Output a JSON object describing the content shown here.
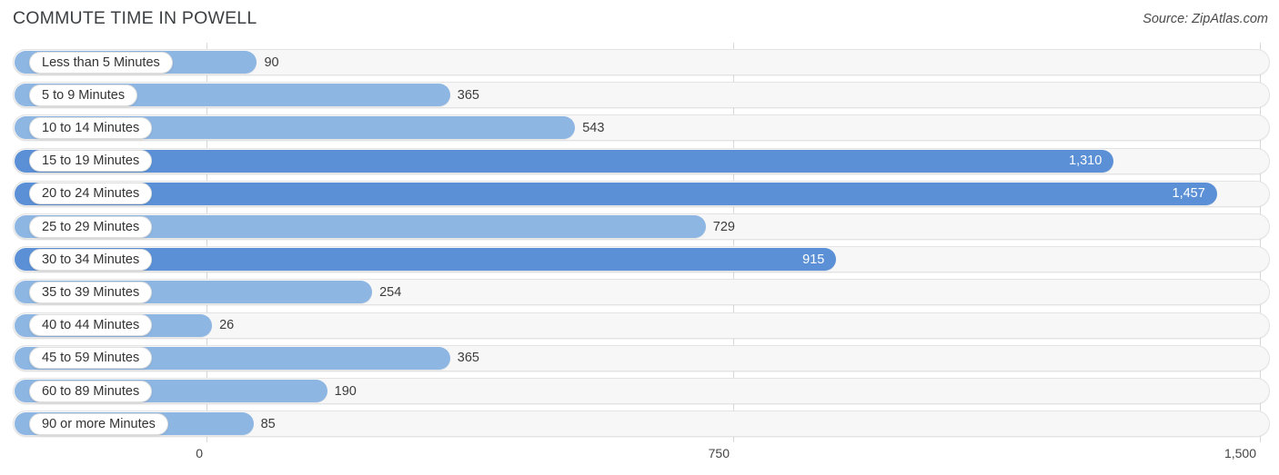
{
  "header": {
    "title": "COMMUTE TIME IN POWELL",
    "source": "Source: ZipAtlas.com"
  },
  "colors": {
    "bar_light": "#8EB6E3",
    "bar_dark": "#5B90D6",
    "track_fill": "#F7F7F7",
    "track_border": "#E3E3E3",
    "gridline": "#D8D8D8",
    "value_outside_text": "#3C3C3C",
    "value_inside_text": "#FFFFFF",
    "title_text": "#3C4043"
  },
  "chart_data": {
    "type": "bar",
    "orientation": "horizontal",
    "title": "COMMUTE TIME IN POWELL",
    "subtitle": "",
    "xlabel": "",
    "ylabel": "",
    "xlim": [
      0,
      1500
    ],
    "grid": true,
    "legend": null,
    "source": "Source: ZipAtlas.com",
    "axis_ticks": [
      {
        "value": 0,
        "label": "0"
      },
      {
        "value": 750,
        "label": "750"
      },
      {
        "value": 1500,
        "label": "1,500"
      }
    ],
    "categories": [
      "Less than 5 Minutes",
      "5 to 9 Minutes",
      "10 to 14 Minutes",
      "15 to 19 Minutes",
      "20 to 24 Minutes",
      "25 to 29 Minutes",
      "30 to 34 Minutes",
      "35 to 39 Minutes",
      "40 to 44 Minutes",
      "45 to 59 Minutes",
      "60 to 89 Minutes",
      "90 or more Minutes"
    ],
    "values": [
      90,
      365,
      543,
      1310,
      1457,
      729,
      915,
      254,
      26,
      365,
      190,
      85
    ],
    "value_labels": [
      "90",
      "365",
      "543",
      "1,310",
      "1,457",
      "729",
      "915",
      "254",
      "26",
      "365",
      "190",
      "85"
    ]
  },
  "rows": [
    {
      "label": "Less than 5 Minutes",
      "value": 90,
      "value_label": "90",
      "shade": "light",
      "label_inside": true
    },
    {
      "label": "5 to 9 Minutes",
      "value": 365,
      "value_label": "365",
      "shade": "light",
      "label_inside": true
    },
    {
      "label": "10 to 14 Minutes",
      "value": 543,
      "value_label": "543",
      "shade": "light",
      "label_inside": true
    },
    {
      "label": "15 to 19 Minutes",
      "value": 1310,
      "value_label": "1,310",
      "shade": "dark",
      "label_inside": false
    },
    {
      "label": "20 to 24 Minutes",
      "value": 1457,
      "value_label": "1,457",
      "shade": "dark",
      "label_inside": false
    },
    {
      "label": "25 to 29 Minutes",
      "value": 729,
      "value_label": "729",
      "shade": "light",
      "label_inside": true
    },
    {
      "label": "30 to 34 Minutes",
      "value": 915,
      "value_label": "915",
      "shade": "dark",
      "label_inside": false
    },
    {
      "label": "35 to 39 Minutes",
      "value": 254,
      "value_label": "254",
      "shade": "light",
      "label_inside": true
    },
    {
      "label": "40 to 44 Minutes",
      "value": 26,
      "value_label": "26",
      "shade": "light",
      "label_inside": true
    },
    {
      "label": "45 to 59 Minutes",
      "value": 365,
      "value_label": "365",
      "shade": "light",
      "label_inside": true
    },
    {
      "label": "60 to 89 Minutes",
      "value": 190,
      "value_label": "190",
      "shade": "light",
      "label_inside": true
    },
    {
      "label": "90 or more Minutes",
      "value": 85,
      "value_label": "85",
      "shade": "light",
      "label_inside": true
    }
  ]
}
